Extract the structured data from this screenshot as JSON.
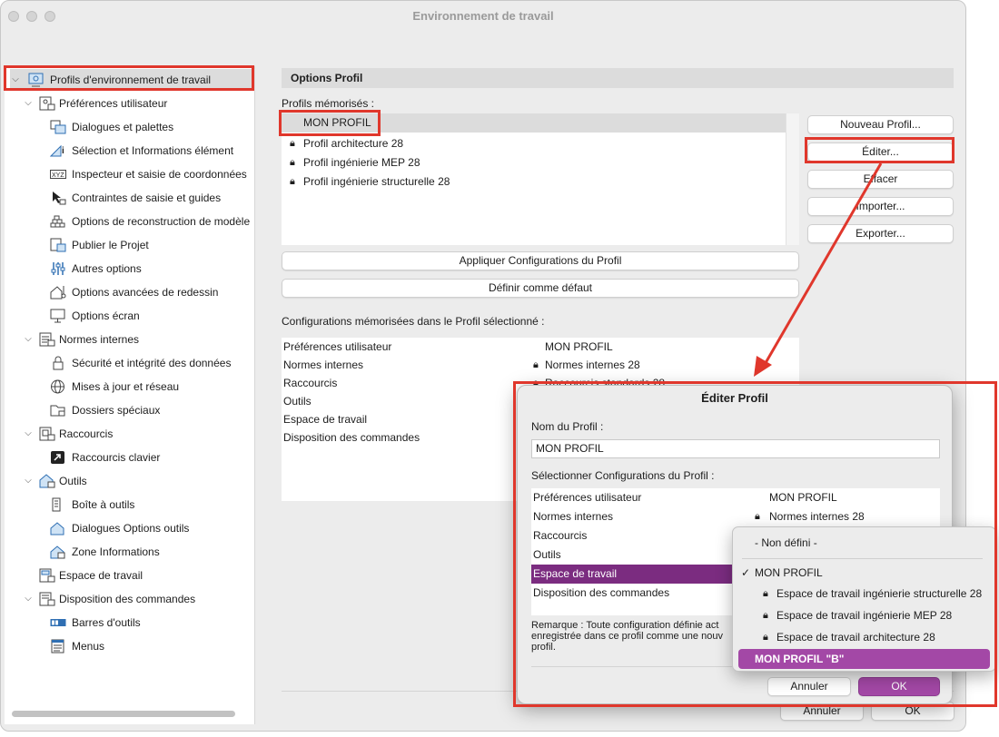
{
  "window": {
    "title": "Environnement de travail"
  },
  "sidebar": {
    "items": [
      {
        "label": "Profils d'environnement de travail",
        "expanded": true
      },
      {
        "label": "Préférences utilisateur",
        "expanded": true
      },
      {
        "label": "Dialogues et palettes"
      },
      {
        "label": "Sélection et Informations élément"
      },
      {
        "label": "Inspecteur et saisie de coordonnées"
      },
      {
        "label": "Contraintes de saisie et guides"
      },
      {
        "label": "Options de reconstruction de modèle"
      },
      {
        "label": "Publier le Projet"
      },
      {
        "label": "Autres options"
      },
      {
        "label": "Options avancées de redessin"
      },
      {
        "label": "Options écran"
      },
      {
        "label": "Normes internes",
        "expanded": true
      },
      {
        "label": "Sécurité et intégrité des données"
      },
      {
        "label": "Mises à jour et réseau"
      },
      {
        "label": "Dossiers spéciaux"
      },
      {
        "label": "Raccourcis",
        "expanded": true
      },
      {
        "label": "Raccourcis clavier"
      },
      {
        "label": "Outils",
        "expanded": true
      },
      {
        "label": "Boîte à outils"
      },
      {
        "label": "Dialogues Options outils"
      },
      {
        "label": "Zone Informations"
      },
      {
        "label": "Espace de travail"
      },
      {
        "label": "Disposition des commandes",
        "expanded": true
      },
      {
        "label": "Barres d'outils"
      },
      {
        "label": "Menus"
      }
    ]
  },
  "main": {
    "section_title": "Options Profil",
    "profiles_label": "Profils mémorisés :",
    "profiles": [
      {
        "name": "MON PROFIL",
        "locked": false,
        "selected": true
      },
      {
        "name": "Profil architecture 28",
        "locked": true
      },
      {
        "name": "Profil ingénierie MEP 28",
        "locked": true
      },
      {
        "name": "Profil ingénierie structurelle 28",
        "locked": true
      }
    ],
    "buttons": {
      "new_profile": "Nouveau Profil...",
      "edit": "Éditer...",
      "delete": "Effacer",
      "import": "Importer...",
      "export": "Exporter...",
      "apply": "Appliquer Configurations du Profil",
      "set_default": "Définir comme défaut",
      "cancel": "Annuler",
      "ok": "OK"
    },
    "configs_label": "Configurations mémorisées dans le Profil sélectionné :",
    "configs": [
      {
        "name": "Préférences utilisateur",
        "value": "MON PROFIL"
      },
      {
        "name": "Normes internes",
        "value": "Normes internes 28"
      },
      {
        "name": "Raccourcis",
        "value": "Raccourcis standards 28"
      },
      {
        "name": "Outils",
        "value": ""
      },
      {
        "name": "Espace de travail",
        "value": ""
      },
      {
        "name": "Disposition des commandes",
        "value": ""
      }
    ]
  },
  "dialog": {
    "title": "Éditer Profil",
    "name_label": "Nom du Profil :",
    "name_value": "MON PROFIL",
    "select_label": "Sélectionner Configurations du Profil :",
    "rows": [
      {
        "name": "Préférences utilisateur",
        "value": "MON PROFIL"
      },
      {
        "name": "Normes internes",
        "value": "Normes internes 28"
      },
      {
        "name": "Raccourcis",
        "value": ""
      },
      {
        "name": "Outils",
        "value": ""
      },
      {
        "name": "Espace de travail",
        "value": ""
      },
      {
        "name": "Disposition des commandes",
        "value": ""
      }
    ],
    "note": "Remarque : Toute configuration définie act enregistrée dans ce profil comme une nouv profil.",
    "cancel": "Annuler",
    "ok": "OK"
  },
  "popup": {
    "items": [
      {
        "label": "- Non défini -"
      },
      {
        "label": "MON PROFIL",
        "checked": true
      },
      {
        "label": "Espace de travail ingénierie structurelle 28",
        "locked": true
      },
      {
        "label": "Espace de travail ingénierie MEP 28",
        "locked": true
      },
      {
        "label": "Espace de travail architecture 28",
        "locked": true
      },
      {
        "label": "MON PROFIL \"B\"",
        "highlighted": true
      }
    ]
  },
  "colors": {
    "accent": "#7b2c80",
    "highlight": "#a348a6",
    "annotation": "#e0372c"
  }
}
